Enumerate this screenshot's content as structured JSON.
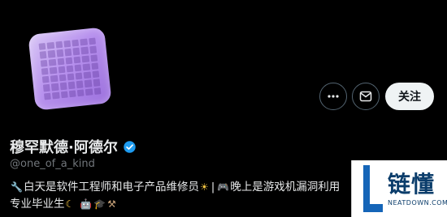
{
  "profile": {
    "display_name": "穆罕默德·阿德尔",
    "handle": "@one_of_a_kind",
    "verified": true,
    "accent_verified": "#1d9bf0"
  },
  "actions": {
    "more_icon": "more-horizontal-icon",
    "message_icon": "envelope-icon",
    "follow_label": "关注"
  },
  "bio": {
    "line1_part1": "白天是软件工程师和电子产品维修员",
    "line1_part2": "|",
    "line1_part3": "晚上是游戏机漏洞利用",
    "line2_part1": "专业毕业生"
  },
  "watermark": {
    "text": "链懂",
    "domain": "NEATDOWN.COM"
  }
}
